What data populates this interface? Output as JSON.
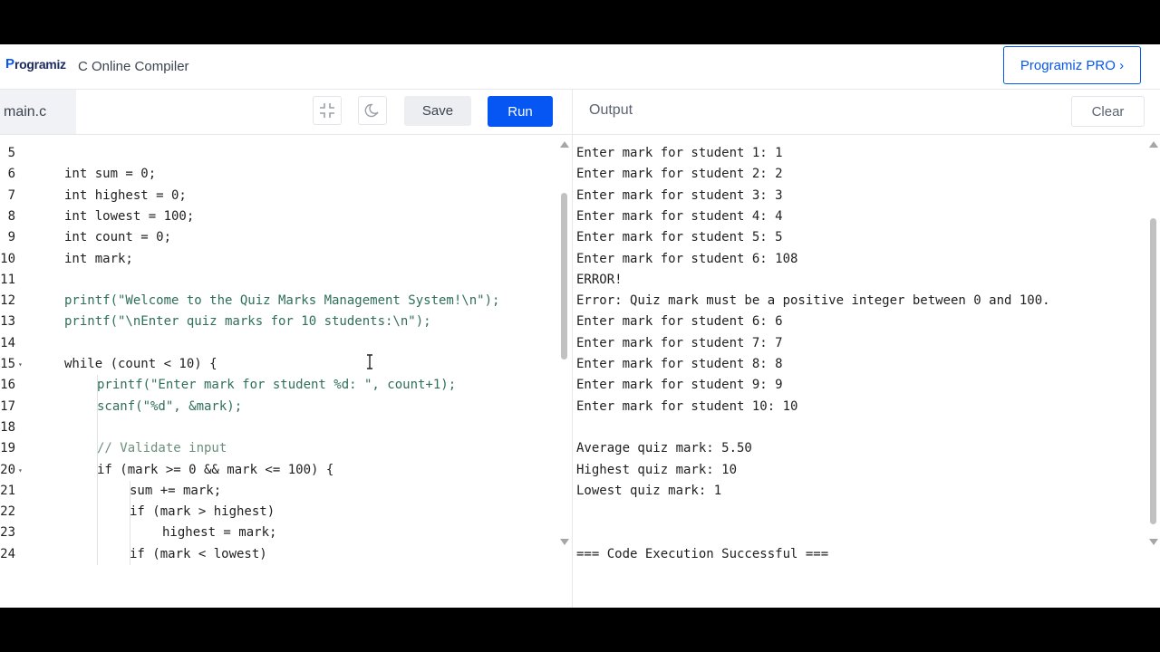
{
  "header": {
    "logo_text": "rogramiz",
    "logo_letter": "P",
    "title": "C Online Compiler",
    "pro_button": "Programiz PRO ›"
  },
  "editor_toolbar": {
    "file_tab": "main.c",
    "save_label": "Save",
    "run_label": "Run"
  },
  "editor": {
    "lines": [
      {
        "n": "5",
        "fold": "",
        "indent": 0,
        "text": ""
      },
      {
        "n": "6",
        "fold": "",
        "indent": 0,
        "text": "int sum = 0;"
      },
      {
        "n": "7",
        "fold": "",
        "indent": 0,
        "text": "int highest = 0;"
      },
      {
        "n": "8",
        "fold": "",
        "indent": 0,
        "text": "int lowest = 100;"
      },
      {
        "n": "9",
        "fold": "",
        "indent": 0,
        "text": "int count = 0;"
      },
      {
        "n": "10",
        "fold": "",
        "indent": 0,
        "text": "int mark;"
      },
      {
        "n": "11",
        "fold": "",
        "indent": 0,
        "text": ""
      },
      {
        "n": "12",
        "fold": "",
        "indent": 0,
        "text": "printf(\"Welcome to the Quiz Marks Management System!\\n\");"
      },
      {
        "n": "13",
        "fold": "",
        "indent": 0,
        "text": "printf(\"\\nEnter quiz marks for 10 students:\\n\");"
      },
      {
        "n": "14",
        "fold": "",
        "indent": 0,
        "text": ""
      },
      {
        "n": "15",
        "fold": "▾",
        "indent": 0,
        "text": "while (count < 10) {"
      },
      {
        "n": "16",
        "fold": "",
        "indent": 1,
        "text": "printf(\"Enter mark for student %d: \", count+1);"
      },
      {
        "n": "17",
        "fold": "",
        "indent": 1,
        "text": "scanf(\"%d\", &mark);"
      },
      {
        "n": "18",
        "fold": "",
        "indent": 0,
        "text": ""
      },
      {
        "n": "19",
        "fold": "",
        "indent": 1,
        "text": "// Validate input"
      },
      {
        "n": "20",
        "fold": "▾",
        "indent": 1,
        "text": "if (mark >= 0 && mark <= 100) {"
      },
      {
        "n": "21",
        "fold": "",
        "indent": 2,
        "text": "sum += mark;"
      },
      {
        "n": "22",
        "fold": "",
        "indent": 2,
        "text": "if (mark > highest)"
      },
      {
        "n": "23",
        "fold": "",
        "indent": 3,
        "text": "highest = mark;"
      },
      {
        "n": "24",
        "fold": "",
        "indent": 2,
        "text": "if (mark < lowest)"
      }
    ]
  },
  "output_toolbar": {
    "title": "Output",
    "clear_label": "Clear"
  },
  "output": {
    "lines": [
      "Enter mark for student 1: 1",
      "Enter mark for student 2: 2",
      "Enter mark for student 3: 3",
      "Enter mark for student 4: 4",
      "Enter mark for student 5: 5",
      "Enter mark for student 6: 108",
      "ERROR!",
      "Error: Quiz mark must be a positive integer between 0 and 100.",
      "Enter mark for student 6: 6",
      "Enter mark for student 7: 7",
      "Enter mark for student 8: 8",
      "Enter mark for student 9: 9",
      "Enter mark for student 10: 10",
      "",
      "Average quiz mark: 5.50",
      "Highest quiz mark: 10",
      "Lowest quiz mark: 1",
      "",
      "",
      "=== Code Execution Successful ==="
    ]
  },
  "colors": {
    "accent": "#0556f3",
    "string": "#2f6f5a",
    "comment": "#6b8f7a"
  },
  "icons": [
    "compress-icon",
    "moon-icon",
    "text-cursor-icon"
  ]
}
